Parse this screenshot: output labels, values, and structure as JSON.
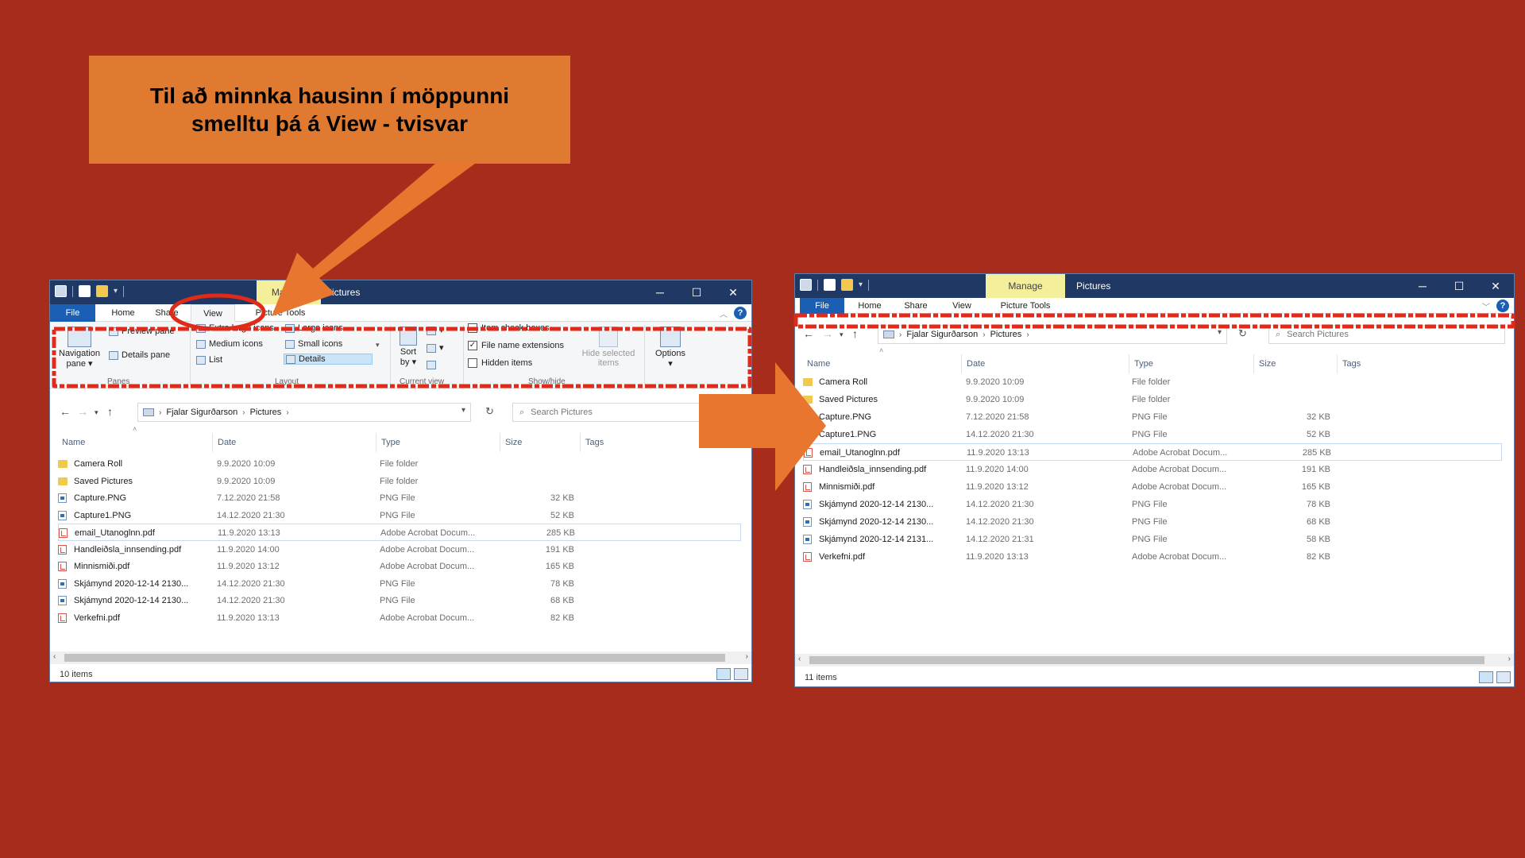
{
  "callout": {
    "line1": "Til að minnka hausinn í möppunni",
    "line2": "smelltu þá á View - tvisvar"
  },
  "left": {
    "context_tab": "Manage",
    "title": "Pictures",
    "tabs": {
      "file": "File",
      "home": "Home",
      "share": "Share",
      "view": "View",
      "picture_tools": "Picture Tools"
    },
    "ribbon": {
      "navigation_pane_1": "Navigation",
      "navigation_pane_2": "pane",
      "preview_pane": "Preview pane",
      "details_pane": "Details pane",
      "extra_large_icons": "Extra large icons",
      "large_icons": "Large icons",
      "medium_icons": "Medium icons",
      "small_icons": "Small icons",
      "list": "List",
      "details": "Details",
      "sort_by_1": "Sort",
      "sort_by_2": "by",
      "item_check_boxes": "Item check boxes",
      "file_name_extensions": "File name extensions",
      "hidden_items": "Hidden items",
      "hide_selected_1": "Hide selected",
      "hide_selected_2": "items",
      "options": "Options",
      "groups": {
        "panes": "Panes",
        "layout": "Layout",
        "current_view": "Current view",
        "show_hide": "Show/hide"
      }
    },
    "address": {
      "user": "Fjalar Sigurðarson",
      "folder": "Pictures"
    },
    "search_placeholder": "Search Pictures",
    "columns": {
      "name": "Name",
      "date": "Date",
      "type": "Type",
      "size": "Size",
      "tags": "Tags"
    },
    "files": [
      {
        "name": "Camera Roll",
        "date": "9.9.2020 10:09",
        "type": "File folder",
        "size": "",
        "icon": "folder-icon"
      },
      {
        "name": "Saved Pictures",
        "date": "9.9.2020 10:09",
        "type": "File folder",
        "size": "",
        "icon": "folder-icon"
      },
      {
        "name": "Capture.PNG",
        "date": "7.12.2020 21:58",
        "type": "PNG File",
        "size": "32 KB",
        "icon": "png-file-icon"
      },
      {
        "name": "Capture1.PNG",
        "date": "14.12.2020 21:30",
        "type": "PNG File",
        "size": "52 KB",
        "icon": "png-file-icon"
      },
      {
        "name": "email_Utanoglnn.pdf",
        "date": "11.9.2020 13:13",
        "type": "Adobe Acrobat Docum...",
        "size": "285 KB",
        "icon": "pdf-file-icon"
      },
      {
        "name": "Handleiðsla_innsending.pdf",
        "date": "11.9.2020 14:00",
        "type": "Adobe Acrobat Docum...",
        "size": "191 KB",
        "icon": "pdf-file-icon"
      },
      {
        "name": "Minnismiði.pdf",
        "date": "11.9.2020 13:12",
        "type": "Adobe Acrobat Docum...",
        "size": "165 KB",
        "icon": "pdf-file-icon"
      },
      {
        "name": "Skjámynd 2020-12-14 2130...",
        "date": "14.12.2020 21:30",
        "type": "PNG File",
        "size": "78 KB",
        "icon": "png-file-icon"
      },
      {
        "name": "Skjámynd 2020-12-14 2130...",
        "date": "14.12.2020 21:30",
        "type": "PNG File",
        "size": "68 KB",
        "icon": "png-file-icon"
      },
      {
        "name": "Verkefni.pdf",
        "date": "11.9.2020 13:13",
        "type": "Adobe Acrobat Docum...",
        "size": "82 KB",
        "icon": "pdf-file-icon"
      }
    ],
    "status": "10 items"
  },
  "right": {
    "context_tab": "Manage",
    "title": "Pictures",
    "tabs": {
      "file": "File",
      "home": "Home",
      "share": "Share",
      "view": "View",
      "picture_tools": "Picture Tools"
    },
    "address": {
      "user": "Fjalar Sigurðarson",
      "folder": "Pictures"
    },
    "search_placeholder": "Search Pictures",
    "columns": {
      "name": "Name",
      "date": "Date",
      "type": "Type",
      "size": "Size",
      "tags": "Tags"
    },
    "files": [
      {
        "name": "Camera Roll",
        "date": "9.9.2020 10:09",
        "type": "File folder",
        "size": "",
        "icon": "folder-icon"
      },
      {
        "name": "Saved Pictures",
        "date": "9.9.2020 10:09",
        "type": "File folder",
        "size": "",
        "icon": "folder-icon"
      },
      {
        "name": "Capture.PNG",
        "date": "7.12.2020 21:58",
        "type": "PNG File",
        "size": "32 KB",
        "icon": "png-file-icon"
      },
      {
        "name": "Capture1.PNG",
        "date": "14.12.2020 21:30",
        "type": "PNG File",
        "size": "52 KB",
        "icon": "png-file-icon"
      },
      {
        "name": "email_Utanoglnn.pdf",
        "date": "11.9.2020 13:13",
        "type": "Adobe Acrobat Docum...",
        "size": "285 KB",
        "icon": "pdf-file-icon"
      },
      {
        "name": "Handleiðsla_innsending.pdf",
        "date": "11.9.2020 14:00",
        "type": "Adobe Acrobat Docum...",
        "size": "191 KB",
        "icon": "pdf-file-icon"
      },
      {
        "name": "Minnismiði.pdf",
        "date": "11.9.2020 13:12",
        "type": "Adobe Acrobat Docum...",
        "size": "165 KB",
        "icon": "pdf-file-icon"
      },
      {
        "name": "Skjámynd 2020-12-14 2130...",
        "date": "14.12.2020 21:30",
        "type": "PNG File",
        "size": "78 KB",
        "icon": "png-file-icon"
      },
      {
        "name": "Skjámynd 2020-12-14 2130...",
        "date": "14.12.2020 21:30",
        "type": "PNG File",
        "size": "68 KB",
        "icon": "png-file-icon"
      },
      {
        "name": "Skjámynd 2020-12-14 2131...",
        "date": "14.12.2020 21:31",
        "type": "PNG File",
        "size": "58 KB",
        "icon": "png-file-icon"
      },
      {
        "name": "Verkefni.pdf",
        "date": "11.9.2020 13:13",
        "type": "Adobe Acrobat Docum...",
        "size": "82 KB",
        "icon": "pdf-file-icon"
      }
    ],
    "status": "11 items"
  },
  "colors": {
    "background": "#a72c1b",
    "callout": "#e07a30",
    "arrow": "#e8762e",
    "highlight": "#e02a1a",
    "titlebar": "#1f3864",
    "file_tab": "#1a5fb4",
    "context_tab": "#f4ef9a"
  }
}
